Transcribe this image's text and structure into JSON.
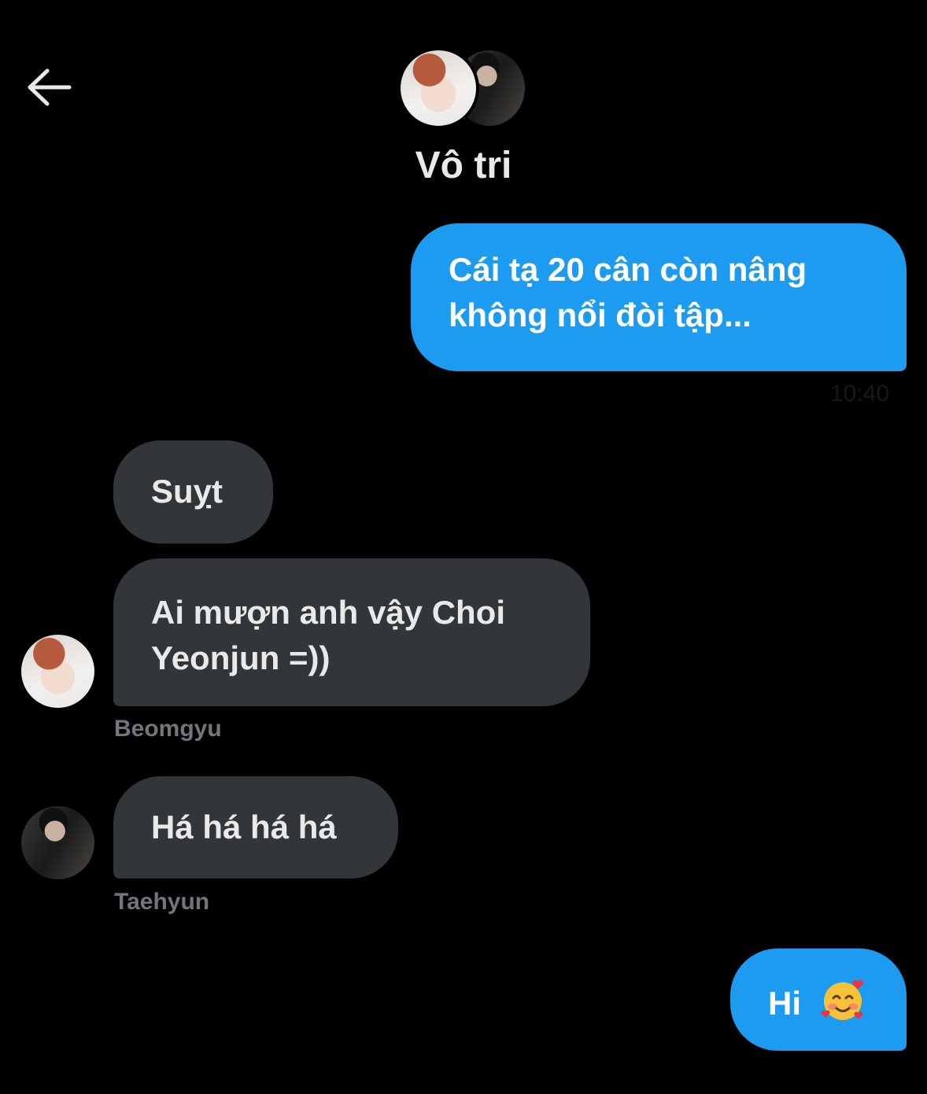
{
  "header": {
    "title": "Vô tri",
    "back_icon": "arrow-left-icon",
    "group_avatars": [
      "avatar-beomgyu",
      "avatar-taehyun"
    ]
  },
  "messages": [
    {
      "direction": "outgoing",
      "text": "Cái tạ 20 cân còn nâng không nổi đòi tập...",
      "time": "10:40"
    },
    {
      "direction": "incoming",
      "text": "Suỵt"
    },
    {
      "direction": "incoming",
      "text": "Ai mượn anh vậy Choi Yeonjun =))",
      "sender": "Beomgyu"
    },
    {
      "direction": "incoming",
      "text": "Há há há há",
      "sender": "Taehyun"
    },
    {
      "direction": "outgoing",
      "text": "Hi",
      "emoji": "smiling-face-with-hearts"
    }
  ],
  "colors": {
    "background": "#000000",
    "outgoing_bubble": "#1d9bf0",
    "incoming_bubble": "#333639",
    "sender_text": "#71767b"
  }
}
